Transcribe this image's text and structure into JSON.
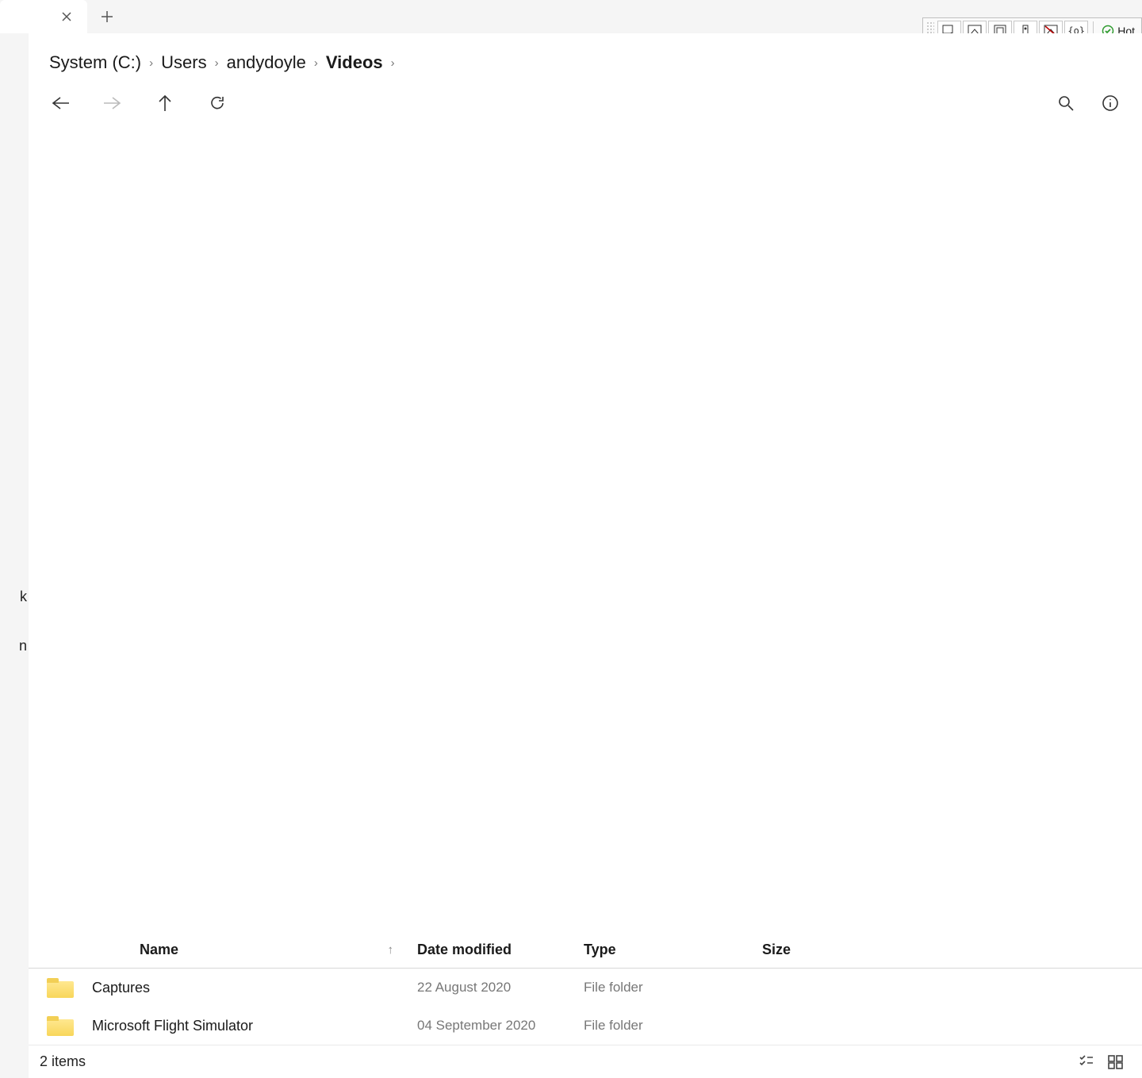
{
  "breadcrumb": [
    {
      "label": "System (C:)",
      "current": false
    },
    {
      "label": "Users",
      "current": false
    },
    {
      "label": "andydoyle",
      "current": false
    },
    {
      "label": "Videos",
      "current": true
    }
  ],
  "columns": {
    "name": "Name",
    "date": "Date modified",
    "type": "Type",
    "size": "Size"
  },
  "rows": [
    {
      "name": "Captures",
      "date": "22 August 2020",
      "type": "File folder",
      "size": ""
    },
    {
      "name": "Microsoft Flight Simulator",
      "date": "04 September 2020",
      "type": "File folder",
      "size": ""
    }
  ],
  "status": "2 items",
  "sidebar_fragments": {
    "a": "k",
    "b": "n"
  },
  "floatbar_label": "Hot"
}
